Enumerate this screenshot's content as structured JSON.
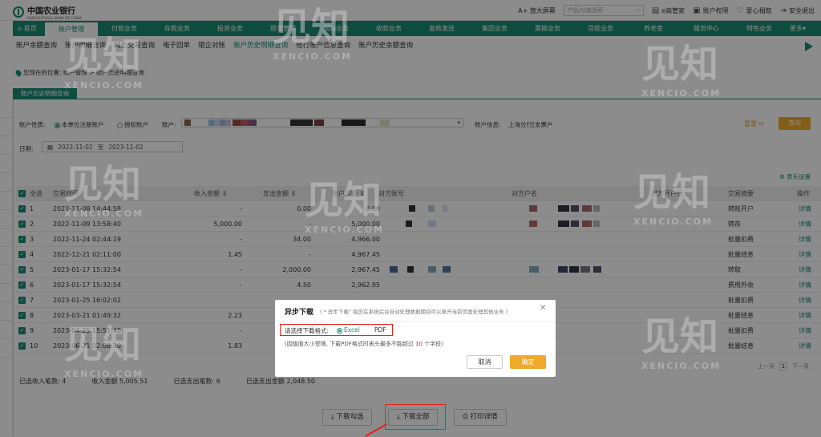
{
  "topbar": {
    "bank_name": "中国农业银行",
    "bank_sub": "AGRICULTURAL BANK OF CHINA",
    "zoom_label": "A+ 放大屏幕",
    "search_placeholder": "产品/功能搜索",
    "links": [
      "e商管家",
      "账户权限",
      "爱心捐款",
      "安全退出"
    ]
  },
  "nav": {
    "items": [
      "首页",
      "账户管理",
      "付款业务",
      "存款业务",
      "投资业务",
      "现金管理",
      "国际业务",
      "收款业务",
      "复核发送",
      "集团业务",
      "票据业务",
      "贷款业务",
      "养老金",
      "服务中心",
      "特色业务",
      "更多"
    ],
    "active_index": 1
  },
  "subnav": {
    "items": [
      "账户余额查询",
      "账户明细查询",
      "网上交易查询",
      "电子回单",
      "银企对账",
      "账户历史明细查询",
      "他行账户信息查询",
      "账户历史余额查询"
    ],
    "active_index": 5
  },
  "breadcrumb": "您现在的位置: 账户管理 > 账户历史明细查询",
  "tab_label": "账户历史明细查询",
  "filters": {
    "account_nature_label": "账户性质:",
    "opt_own": "本单位注册账户",
    "opt_auth": "授权账户",
    "account_label": "账户:",
    "account_info_label": "账户信息:",
    "account_info_value": "上海分行[支票户",
    "reset_label": "重置",
    "query_label": "查询",
    "date_label": "日期:",
    "date_from": "2022-11-02",
    "date_sep": "至",
    "date_to": "2023-11-02"
  },
  "table": {
    "settings_label": "表头设置",
    "headers": [
      "全选",
      "交易时间",
      "收入金额",
      "支出金额",
      "账户余额",
      "对方账号",
      "对方户名",
      "对方开户行",
      "交易摘要",
      "操作"
    ],
    "rows": [
      {
        "no": "1",
        "time": "2022-11-08 14:44:58",
        "income": "-",
        "expense": "0.00",
        "balance": "0.00",
        "summary": "转账开户",
        "op": "详情"
      },
      {
        "no": "2",
        "time": "2022-11-09 13:58:40",
        "income": "5,000.00",
        "expense": "-",
        "balance": "5,000.00",
        "summary": "转存",
        "op": "详情"
      },
      {
        "no": "3",
        "time": "2022-11-24 02:44:19",
        "income": "-",
        "expense": "34.00",
        "balance": "4,966.00",
        "summary": "批量扣费",
        "op": "详情"
      },
      {
        "no": "4",
        "time": "2022-12-21 02:11:00",
        "income": "1.45",
        "expense": "-",
        "balance": "4,967.45",
        "summary": "批量结息",
        "op": "详情"
      },
      {
        "no": "5",
        "time": "2023-01-17 15:32:54",
        "income": "-",
        "expense": "2,000.00",
        "balance": "2,967.45",
        "summary": "转取",
        "op": "详情"
      },
      {
        "no": "6",
        "time": "2023-01-17 15:32:54",
        "income": "-",
        "expense": "4.50",
        "balance": "2,962.95",
        "summary": "费用外收",
        "op": "详情"
      },
      {
        "no": "7",
        "time": "2023-01-25 16:02:02",
        "income": "",
        "expense": "",
        "balance": "",
        "summary": "批量扣费",
        "op": "详情"
      },
      {
        "no": "8",
        "time": "2023-03-21 01:49:32",
        "income": "2.23",
        "expense": "",
        "balance": "",
        "summary": "批量结息",
        "op": "详情"
      },
      {
        "no": "9",
        "time": "2023-04-25 15:51:40",
        "income": "-",
        "expense": "",
        "balance": "",
        "summary": "批量扣费",
        "op": "详情"
      },
      {
        "no": "10",
        "time": "2023-06-21 02:08:20",
        "income": "1.83",
        "expense": "",
        "balance": "",
        "summary": "批量结息",
        "op": "详情"
      }
    ]
  },
  "pager": {
    "prev": "上一页",
    "page": "1",
    "next": "下一页"
  },
  "summary": {
    "selected_income_count": "已选收入笔数: 4",
    "income_amount": "收入金额 5,005.51",
    "selected_expense_count": "已选支出笔数: 6",
    "expense_amount": "已选支出金额 2,048.50"
  },
  "actions": {
    "download_selected": "下载勾选",
    "download_all": "下载全部",
    "print_detail": "打印详情"
  },
  "modal": {
    "title": "异步下载",
    "note": "( * 异步下载\" 指您在系统后台自动处理数据期间可以离开当前页面处理其他业务 )",
    "format_label": "请选择下载格式:",
    "opt_excel": "Excel",
    "opt_pdf": "PDF",
    "tip_prefix": "(因版面大小受限, 下载PDF格式时表头最多不能超过",
    "tip_num": "10",
    "tip_suffix": "个字段)",
    "cancel": "取消",
    "ok": "确定"
  },
  "watermark": {
    "text": "见知",
    "sub": "XENCIO.COM"
  },
  "colors": {
    "brand": "#1a8b74",
    "accent": "#f0a928",
    "highlight": "#e2231a"
  }
}
